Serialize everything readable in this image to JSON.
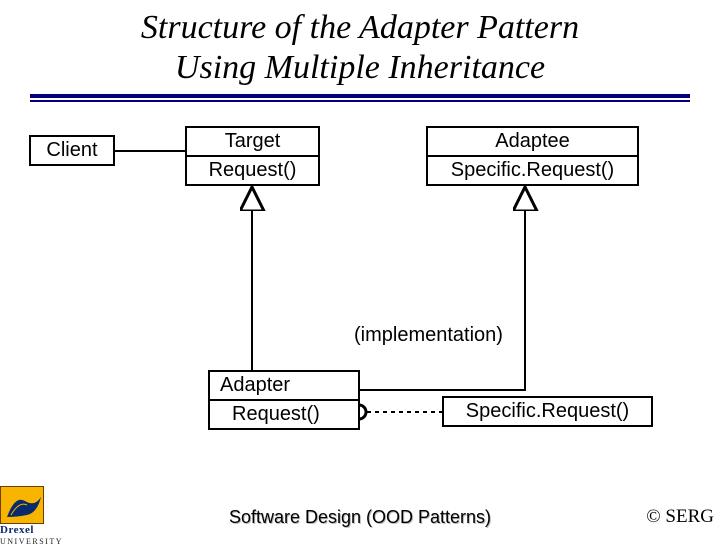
{
  "title_line1": "Structure of the Adapter Pattern",
  "title_line2": "Using Multiple Inheritance",
  "boxes": {
    "client": {
      "name": "Client"
    },
    "target": {
      "name": "Target",
      "op": "Request()"
    },
    "adaptee": {
      "name": "Adaptee",
      "op": "Specific.Request()"
    },
    "adapter": {
      "name": "Adapter",
      "op": "Request()"
    },
    "impl_note": "Specific.Request()"
  },
  "edge_label": "(implementation)",
  "footer": {
    "logo_text": "Drexel",
    "logo_sub": "UNIVERSITY",
    "center": "Software Design (OOD Patterns)",
    "right": "© SERG"
  }
}
